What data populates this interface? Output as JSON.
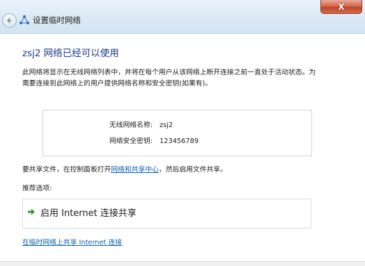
{
  "window": {
    "title": "设置临时网络",
    "close_symbol": "X"
  },
  "main": {
    "heading": "zsj2 网络已经可以使用",
    "description": "此网络将显示在无线网络列表中，并将在每个用户从该网络上断开连接之前一直处于活动状态。为需要连接到此网络上的用户提供网络名称和安全密钥(如果有)。",
    "info": {
      "name_label": "无线网络名称:",
      "name_value": "zsj2",
      "key_label": "网络安全密钥:",
      "key_value": "123456789"
    },
    "share_note": {
      "before": "要共享文件，在控制面板打开",
      "link": "网络和共享中心",
      "after": "，然后启用文件共享。"
    },
    "recommended_label": "推荐选项:",
    "option": {
      "label": "启用 Internet 连接共享",
      "icon": "green-arrow-icon"
    },
    "bottom_link": "在临时网络上共享 Internet 连接"
  },
  "colors": {
    "heading": "#1f3c8e",
    "link": "#0b62b0",
    "arrow": "#2e9a2e",
    "close": "#c1452a"
  }
}
